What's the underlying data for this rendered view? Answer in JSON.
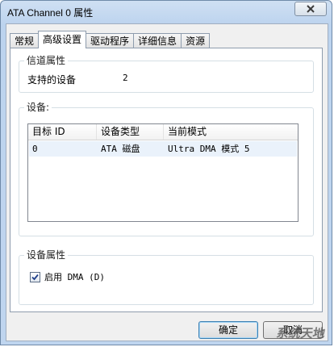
{
  "window": {
    "title": "ATA Channel 0 属性"
  },
  "tabs": [
    {
      "label": "常规",
      "active": false
    },
    {
      "label": "高级设置",
      "active": true
    },
    {
      "label": "驱动程序",
      "active": false
    },
    {
      "label": "详细信息",
      "active": false
    },
    {
      "label": "资源",
      "active": false
    }
  ],
  "channel_props": {
    "title": "信道属性",
    "supported_devices_label": "支持的设备",
    "supported_devices_value": "2"
  },
  "devices": {
    "title": "设备:",
    "columns": [
      "目标 ID",
      "设备类型",
      "当前模式"
    ],
    "rows": [
      {
        "target_id": "0",
        "device_type": "ATA 磁盘",
        "mode": "Ultra DMA 模式 5"
      }
    ]
  },
  "device_props": {
    "title": "设备属性",
    "enable_dma_label": "启用 DMA (D)",
    "enable_dma_checked": true
  },
  "buttons": {
    "ok": "确定",
    "cancel": "取消"
  },
  "watermark": "系统天地"
}
